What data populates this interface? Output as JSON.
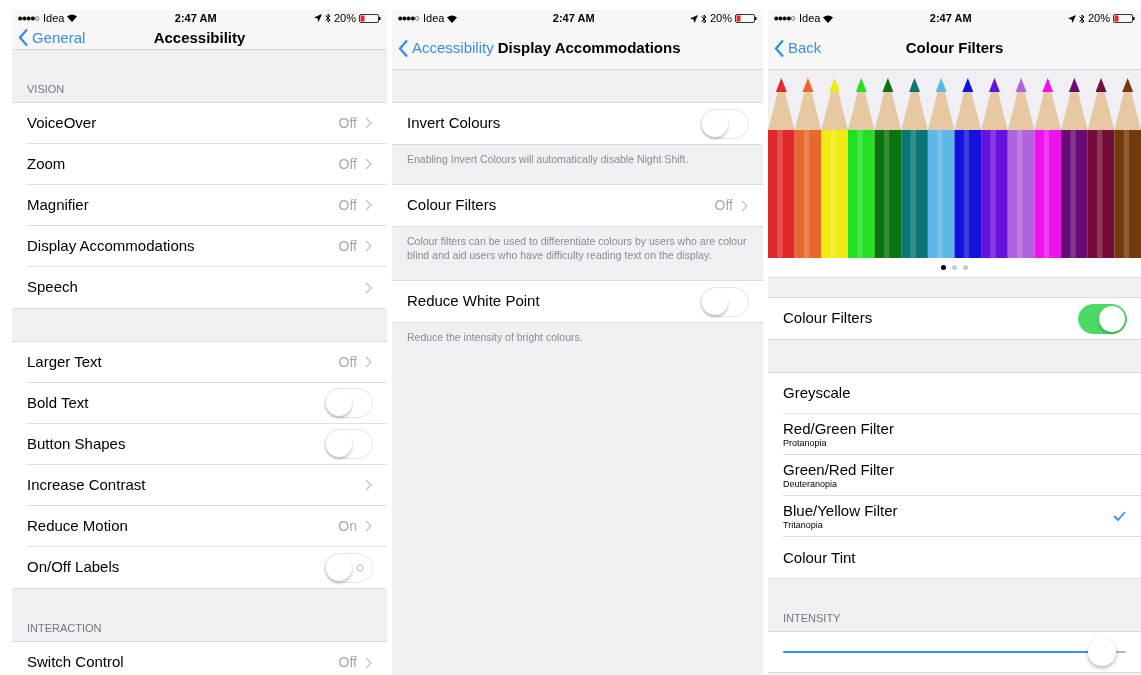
{
  "screens": [
    {
      "status": {
        "carrier": "Idea",
        "time": "2:47 AM",
        "battery": "20%"
      },
      "nav": {
        "back": "General",
        "title": "Accessibility"
      },
      "sections": [
        {
          "header": "VISION",
          "rows": [
            {
              "kind": "link",
              "label": "VoiceOver",
              "value": "Off"
            },
            {
              "kind": "link",
              "label": "Zoom",
              "value": "Off"
            },
            {
              "kind": "link",
              "label": "Magnifier",
              "value": "Off"
            },
            {
              "kind": "link",
              "label": "Display Accommodations",
              "value": "Off"
            },
            {
              "kind": "link",
              "label": "Speech"
            }
          ]
        },
        {
          "rows": [
            {
              "kind": "link",
              "label": "Larger Text",
              "value": "Off"
            },
            {
              "kind": "toggle",
              "label": "Bold Text",
              "on": false
            },
            {
              "kind": "toggle",
              "label": "Button Shapes",
              "on": false
            },
            {
              "kind": "link",
              "label": "Increase Contrast"
            },
            {
              "kind": "link",
              "label": "Reduce Motion",
              "value": "On"
            },
            {
              "kind": "toggle_labels",
              "label": "On/Off Labels",
              "on": false
            }
          ]
        },
        {
          "header": "INTERACTION",
          "rows": [
            {
              "kind": "link",
              "label": "Switch Control",
              "value": "Off"
            }
          ]
        }
      ]
    },
    {
      "status": {
        "carrier": "Idea",
        "time": "2:47 AM",
        "battery": "20%"
      },
      "nav": {
        "back": "Accessibility",
        "title": "Display Accommodations"
      },
      "sections": [
        {
          "rows": [
            {
              "kind": "toggle",
              "label": "Invert Colours",
              "on": false
            }
          ],
          "footer": "Enabling Invert Colours will automatically disable Night Shift."
        },
        {
          "rows": [
            {
              "kind": "link",
              "label": "Colour Filters",
              "value": "Off"
            }
          ],
          "footer": "Colour filters can be used to differentiate colours by users who are colour blind and aid users who have difficulty reading text on the display."
        },
        {
          "rows": [
            {
              "kind": "toggle",
              "label": "Reduce White Point",
              "on": false
            }
          ],
          "footer": "Reduce the intensity of bright colours."
        }
      ]
    },
    {
      "status": {
        "carrier": "Idea",
        "time": "2:47 AM",
        "battery": "20%"
      },
      "nav": {
        "back": "Back",
        "title": "Colour Filters"
      },
      "sections": [
        {
          "kind": "banner",
          "page_dots": [
            {
              "selected": true
            },
            {
              "selected": false
            },
            {
              "selected": false
            }
          ]
        },
        {
          "rows": [
            {
              "kind": "toggle",
              "label": "Colour Filters",
              "on": true
            }
          ]
        },
        {
          "rows": [
            {
              "kind": "option",
              "label": "Greyscale",
              "checked": false
            },
            {
              "kind": "option",
              "label": "Red/Green Filter",
              "subtitle": "Protanopia",
              "checked": false
            },
            {
              "kind": "option",
              "label": "Green/Red Filter",
              "subtitle": "Deuteranopia",
              "checked": false
            },
            {
              "kind": "option",
              "label": "Blue/Yellow Filter",
              "subtitle": "Tritanopia",
              "checked": true
            },
            {
              "kind": "option",
              "label": "Colour Tint",
              "checked": false
            }
          ]
        },
        {
          "header": "INTENSITY",
          "rows": [
            {
              "kind": "slider",
              "level": 0.97
            }
          ]
        }
      ]
    }
  ]
}
